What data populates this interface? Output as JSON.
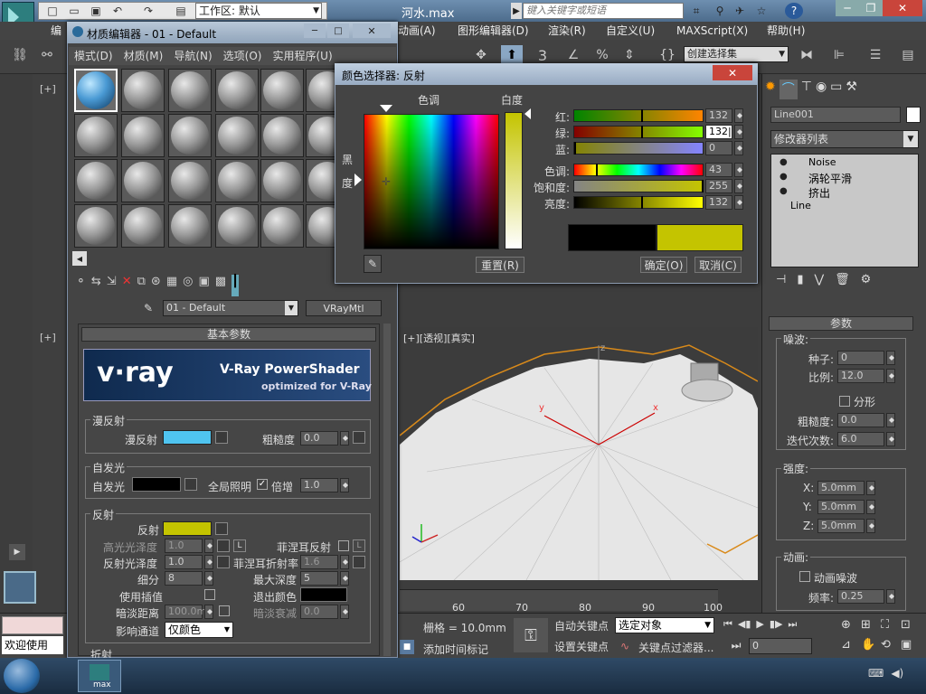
{
  "titlebar": {
    "workspace_label": "工作区: 默认",
    "filename": "河水.max",
    "search_placeholder": "键入关键字或短语"
  },
  "main_menu": [
    "动画(A)",
    "图形编辑器(D)",
    "渲染(R)",
    "自定义(U)",
    "MAXScript(X)",
    "帮助(H)"
  ],
  "main_menu_left": "编",
  "toolbar": {
    "selection_set": "创建选择集",
    "counter": "3"
  },
  "mat_editor": {
    "title": "材质编辑器 - 01 - Default",
    "menus": [
      "模式(D)",
      "材质(M)",
      "导航(N)",
      "选项(O)",
      "实用程序(U)"
    ],
    "material_name": "01 - Default",
    "material_type": "VRayMtl",
    "rollout_title": "基本参数",
    "vray_logo": "v·ray",
    "vray_title": "V-Ray PowerShader",
    "vray_sub": "optimized for V-Ray",
    "diffuse": {
      "group": "漫反射",
      "label": "漫反射",
      "roughness_label": "粗糙度",
      "roughness": "0.0",
      "color": "#4fc4f0"
    },
    "selfillum": {
      "group": "自发光",
      "label": "自发光",
      "gi_label": "全局照明",
      "mult_label": "倍增",
      "mult": "1.0",
      "color": "#000000"
    },
    "reflect": {
      "group": "反射",
      "label": "反射",
      "color": "#c4c400",
      "hilight_gloss_label": "高光光泽度",
      "hilight_gloss": "1.0",
      "L": "L",
      "fresnel_label": "菲涅耳反射",
      "refl_gloss_label": "反射光泽度",
      "refl_gloss": "1.0",
      "fresnel_ior_label": "菲涅耳折射率",
      "fresnel_ior": "1.6",
      "subdivs_label": "细分",
      "subdivs": "8",
      "max_depth_label": "最大深度",
      "max_depth": "5",
      "use_interp_label": "使用插值",
      "exit_color_label": "退出颜色",
      "dim_dist_label": "暗淡距离",
      "dim_dist": "100.0m",
      "dim_falloff_label": "暗淡衰减",
      "dim_falloff": "0.0",
      "affect_label": "影响通道",
      "affect_value": "仅颜色"
    },
    "refract_group": "折射"
  },
  "color_picker": {
    "title": "颜色选择器: 反射",
    "hue_label": "色调",
    "white_label": "白度",
    "black_label": "黑",
    "degree_label": "度",
    "sliders": [
      {
        "label": "红:",
        "value": "132",
        "knob": 0.52
      },
      {
        "label": "绿:",
        "value": "132|",
        "knob": 0.52
      },
      {
        "label": "蓝:",
        "value": "0",
        "knob": 0.0
      },
      {
        "label": "色调:",
        "value": "43",
        "knob": 0.17
      },
      {
        "label": "饱和度:",
        "value": "255",
        "knob": 1.0
      },
      {
        "label": "亮度:",
        "value": "132",
        "knob": 0.52
      }
    ],
    "reset_label": "重置(R)",
    "ok_label": "确定(O)",
    "cancel_label": "取消(C)",
    "old_color": "#000000",
    "new_color": "#c4c400"
  },
  "command_panel": {
    "object_name": "Line001",
    "modifier_list": "修改器列表",
    "stack": [
      "Noise",
      "涡轮平滑",
      "挤出",
      "Line"
    ],
    "params_title": "参数",
    "noise_group": "噪波:",
    "seed_label": "种子:",
    "seed": "0",
    "scale_label": "比例:",
    "scale": "12.0",
    "fractal_label": "分形",
    "roughness_label": "粗糙度:",
    "roughness": "0.0",
    "iter_label": "迭代次数:",
    "iter": "6.0",
    "strength_group": "强度:",
    "x_label": "X:",
    "x": "5.0mm",
    "y_label": "Y:",
    "y": "5.0mm",
    "z_label": "Z:",
    "z": "5.0mm",
    "anim_group": "动画:",
    "anim_noise_label": "动画噪波",
    "freq_label": "频率:",
    "freq": "0.25"
  },
  "viewport": {
    "label": "[+][透视][真实]",
    "left_top_label": "[+]",
    "left_mid_label": "[+]",
    "axis_y": "y",
    "axis_x": "x",
    "axis_z": "z"
  },
  "timeline": {
    "ticks": [
      "60",
      "70",
      "80",
      "90",
      "100"
    ]
  },
  "status": {
    "welcome": "欢迎使用",
    "grid": "栅格 = 10.0mm",
    "add_time_tag": "添加时间标记",
    "auto_key": "自动关键点",
    "set_key": "设置关键点",
    "selected_obj": "选定对象",
    "key_filter": "关键点过滤器...",
    "frame": "0"
  },
  "taskbar": {
    "app_label": "max"
  }
}
